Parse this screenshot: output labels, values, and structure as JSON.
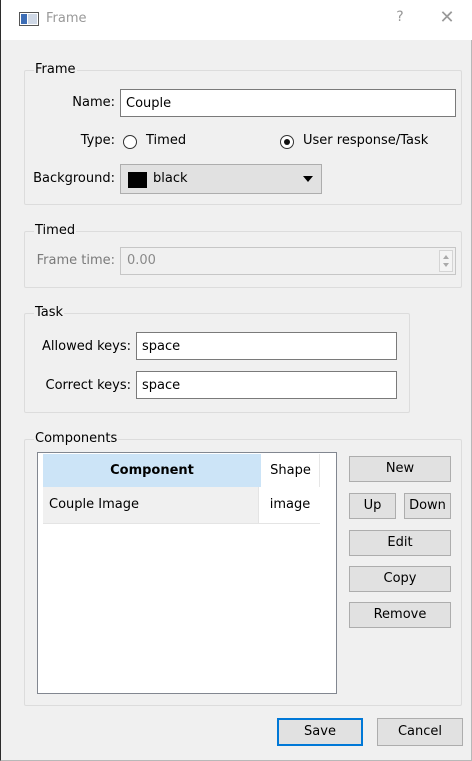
{
  "window": {
    "title": "Frame",
    "help": "?",
    "close": "✕"
  },
  "frame_group": {
    "title": "Frame",
    "name_label": "Name:",
    "name_value": "Couple",
    "type_label": "Type:",
    "type_options": [
      "Timed",
      "User response/Task"
    ],
    "type_selected": "User response/Task",
    "background_label": "Background:",
    "background_value": "black",
    "background_color": "#000000"
  },
  "timed_group": {
    "title": "Timed",
    "frame_time_label": "Frame time:",
    "frame_time_value": "0.00"
  },
  "task_group": {
    "title": "Task",
    "allowed_keys_label": "Allowed keys:",
    "allowed_keys_value": "space",
    "correct_keys_label": "Correct keys:",
    "correct_keys_value": "space"
  },
  "components_group": {
    "title": "Components",
    "columns": [
      "Component",
      "Shape"
    ],
    "rows": [
      {
        "component": "Couple Image",
        "shape": "image"
      }
    ],
    "buttons": {
      "new": "New",
      "up": "Up",
      "down": "Down",
      "edit": "Edit",
      "copy": "Copy",
      "remove": "Remove"
    }
  },
  "footer": {
    "save": "Save",
    "cancel": "Cancel"
  },
  "colors": {
    "header_highlight": "#cce4f7",
    "accent": "#0078d7"
  }
}
